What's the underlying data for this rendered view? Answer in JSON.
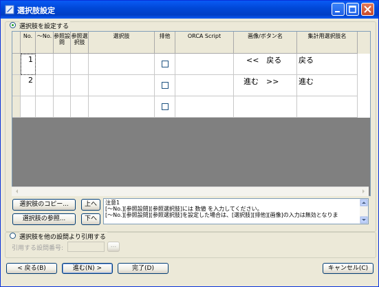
{
  "window": {
    "title": "選択肢設定"
  },
  "section1": {
    "radio_label": "選択肢を設定する",
    "selected": true
  },
  "table": {
    "columns": [
      "No.",
      "〜No.",
      "参照設問",
      "参照選択肢",
      "選択肢",
      "排他",
      "ORCA Script",
      "画像/ボタン名",
      "集計用選択肢名"
    ],
    "rows": [
      {
        "no": "1",
        "image": "<<　戻る",
        "agg": "戻る",
        "exclusive": false
      },
      {
        "no": "2",
        "image": "進む　>>",
        "agg": "進む",
        "exclusive": false
      },
      {
        "no": "",
        "image": "",
        "agg": "",
        "exclusive": false
      }
    ]
  },
  "buttons": {
    "copy": "選択肢のコピー...",
    "ref": "選択肢の参照...",
    "up": "上へ",
    "down": "下へ"
  },
  "note": {
    "lines": [
      "注意1",
      "[〜No.][参照設問][参照選択肢]には 数値 を入力してください。",
      "[〜No.][参照設問][参照選択肢]を設定した場合は、[選択肢][排他][画像]の入力は無効となりま"
    ]
  },
  "section2": {
    "radio_label": "選択肢を他の設問より引用する",
    "field_label": "引用する設問番号:",
    "browse": "..."
  },
  "footer": {
    "back": "< 戻る(B)",
    "next": "進む(N) >",
    "finish": "完了(D)",
    "cancel": "キャンセル(C)"
  }
}
